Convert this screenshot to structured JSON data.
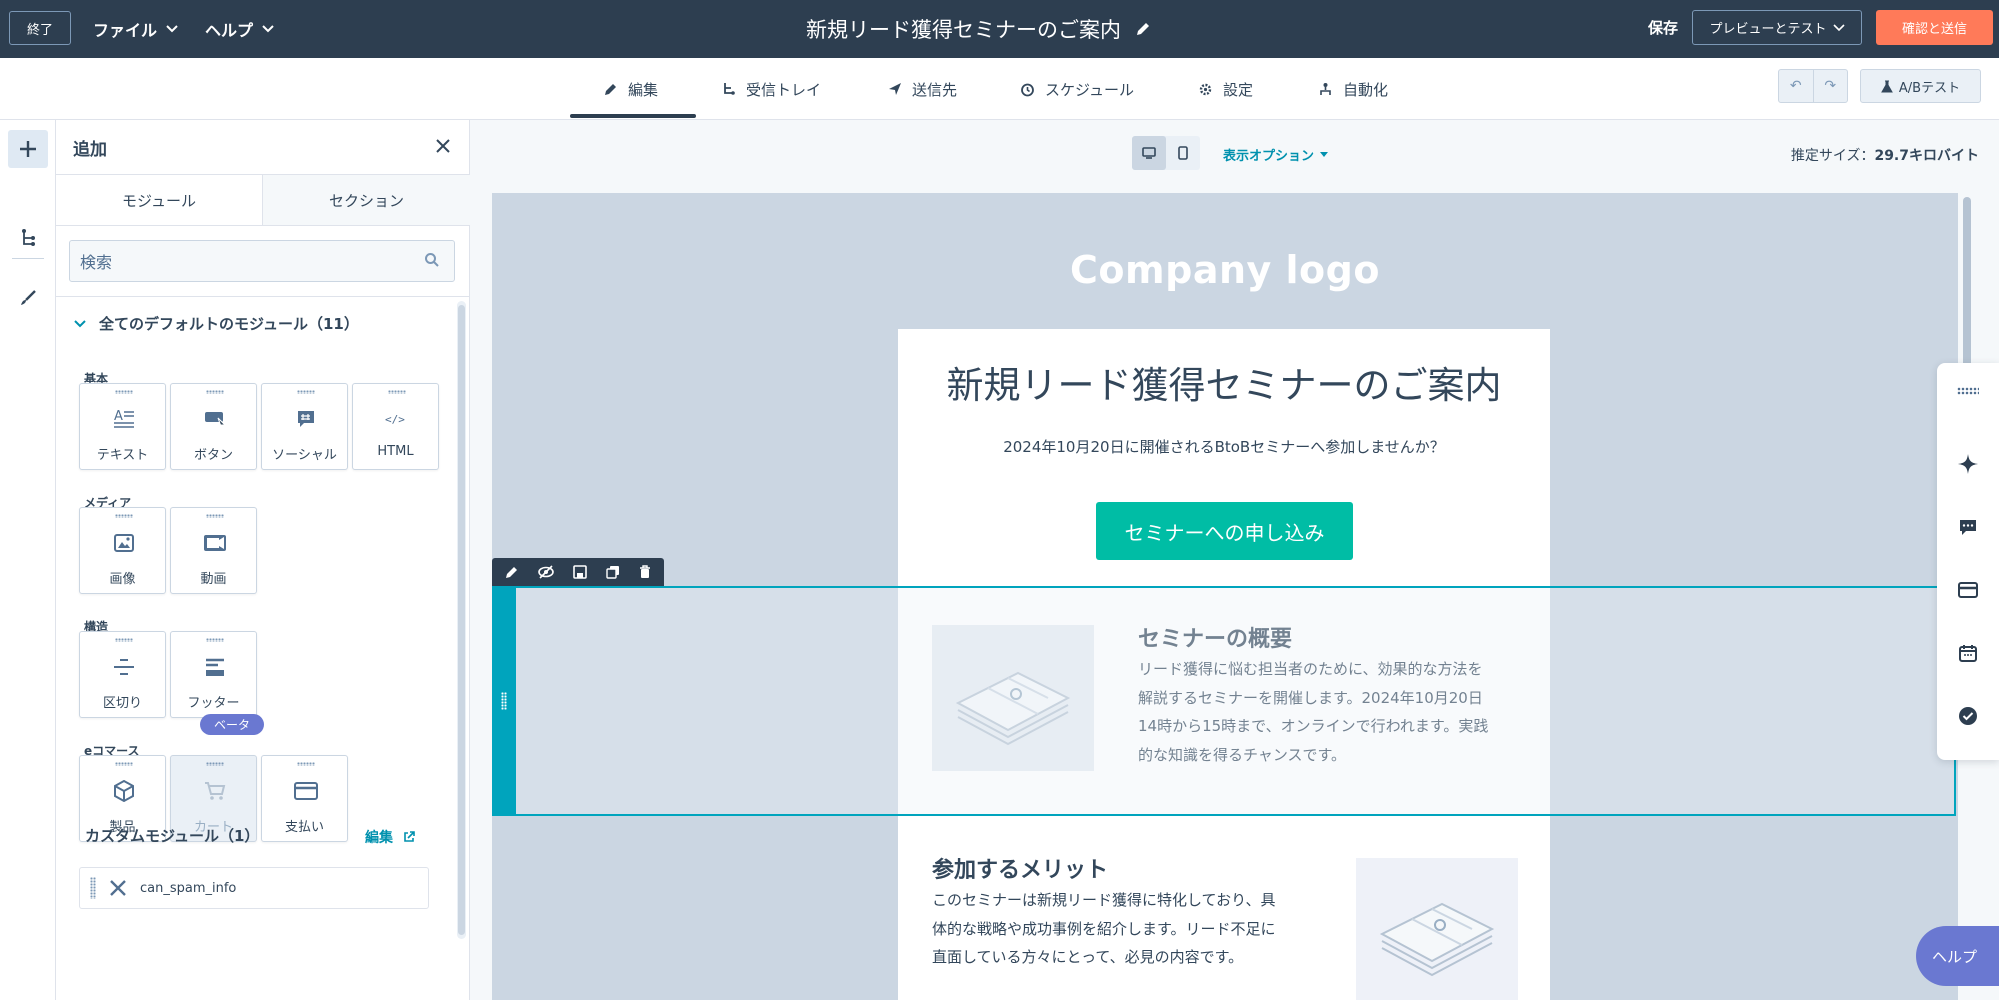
{
  "topbar": {
    "exit_label": "終了",
    "file_menu": "ファイル",
    "help_menu": "ヘルプ",
    "title": "新規リード獲得セミナーのご案内",
    "save_label": "保存",
    "preview_label": "プレビューとテスト",
    "send_label": "確認と送信"
  },
  "tabs": [
    {
      "label": "編集",
      "icon": "pencil-icon",
      "active": true
    },
    {
      "label": "受信トレイ",
      "icon": "inbox-icon"
    },
    {
      "label": "送信先",
      "icon": "send-icon"
    },
    {
      "label": "スケジュール",
      "icon": "clock-icon"
    },
    {
      "label": "設定",
      "icon": "gear-icon"
    },
    {
      "label": "自動化",
      "icon": "workflow-icon"
    }
  ],
  "ab_test_label": "A/Bテスト",
  "panel": {
    "title": "追加",
    "segments": [
      "モジュール",
      "セクション"
    ],
    "search_placeholder": "検索",
    "default_group": "全てのデフォルトのモジュール（11）",
    "categories": [
      "基本",
      "メディア",
      "構造",
      "eコマース"
    ],
    "modules": {
      "text": "テキスト",
      "button": "ボタン",
      "social": "ソーシャル",
      "html": "HTML",
      "image": "画像",
      "video": "動画",
      "divider": "区切り",
      "footer": "フッター",
      "product": "製品",
      "cart": "カート",
      "payment": "支払い"
    },
    "beta_label": "ベータ",
    "custom_group": "カスタムモジュール（1）",
    "custom_edit": "編集",
    "custom_item": "can_spam_info"
  },
  "canvas": {
    "view_options": "表示オプション",
    "size_label": "推定サイズ：",
    "size_value": "29.7キロバイト"
  },
  "email": {
    "logo": "Company logo",
    "title": "新規リード獲得セミナーのご案内",
    "subtitle": "2024年10月20日に開催されるBtoBセミナーへ参加しませんか？",
    "cta": "セミナーへの申し込み",
    "overview_title": "セミナーの概要",
    "overview_lines": [
      "リード獲得に悩む担当者のために、効果的な方法を",
      "解説するセミナーを開催します。2024年10月20日",
      "14時から15時まで、オンラインで行われます。実践",
      "的な知識を得るチャンスです。"
    ],
    "benefit_title": "参加するメリット",
    "benefit_lines": [
      "このセミナーは新規リード獲得に特化しており、具",
      "体的な戦略や成功事例を紹介します。リード不足に",
      "直面している方々にとって、必見の内容です。"
    ]
  },
  "help_label": "ヘルプ"
}
